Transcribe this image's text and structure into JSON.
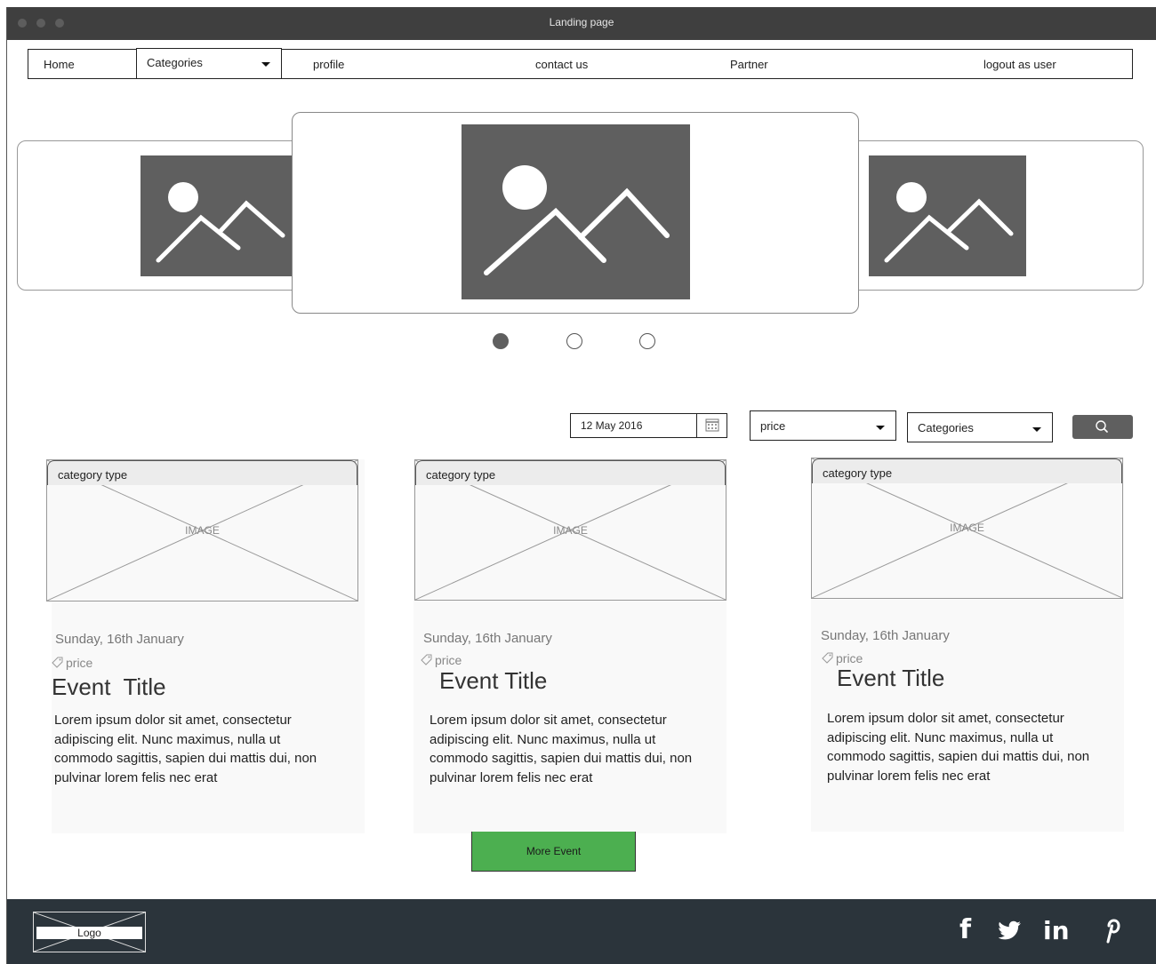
{
  "window": {
    "title": "Landing page"
  },
  "nav": {
    "home": "Home",
    "categories": "Categories",
    "profile": "profile",
    "contact": "contact us",
    "partner": "Partner",
    "logout": "logout as user"
  },
  "carousel": {
    "slides": 3,
    "active_index": 0
  },
  "filters": {
    "date_value": "12 May 2016",
    "price_value": "price",
    "categories_value": "Categories"
  },
  "cards": [
    {
      "category": "category type",
      "image_label": "IMAGE",
      "date": "Sunday, 16th January",
      "price": "price",
      "title": "Event  Title",
      "description": "Lorem ipsum dolor sit amet, consectetur adipiscing elit. Nunc maximus, nulla ut commodo sagittis, sapien dui mattis dui, non pulvinar lorem felis nec erat"
    },
    {
      "category": "category type",
      "image_label": "IMAGE",
      "date": "Sunday, 16th January",
      "price": "price",
      "title": "Event Title",
      "description": "Lorem ipsum dolor sit amet, consectetur adipiscing elit. Nunc maximus, nulla ut commodo sagittis, sapien dui mattis dui, non pulvinar lorem felis nec erat"
    },
    {
      "category": "category type",
      "image_label": "IMAGE",
      "date": "Sunday, 16th January",
      "price": "price",
      "title": "Event Title",
      "description": "Lorem ipsum dolor sit amet, consectetur adipiscing elit. Nunc maximus, nulla ut commodo sagittis, sapien dui mattis dui, non pulvinar lorem felis nec erat"
    }
  ],
  "more_button": "More Event",
  "footer": {
    "logo": "Logo",
    "social_icons": [
      "facebook-icon",
      "twitter-icon",
      "linkedin-icon",
      "pinterest-icon"
    ],
    "facebook": "f",
    "linkedin": "in"
  },
  "colors": {
    "titlebar": "#3f3f3f",
    "footer": "#2b343b",
    "primary_button": "#4caf50",
    "placeholder": "#5f5f5f"
  }
}
